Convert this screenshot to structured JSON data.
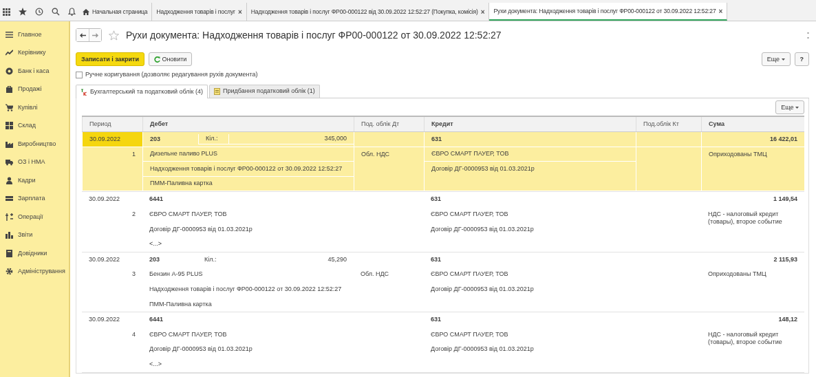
{
  "top_tabs": [
    {
      "kind": "home",
      "label": "Начальная страница",
      "closable": false,
      "selected": false
    },
    {
      "kind": "doc",
      "label": "Надходження товарів і послуг",
      "closable": true,
      "selected": false
    },
    {
      "kind": "doc",
      "label": "Надходження товарів і послуг ФР00-000122 від 30.09.2022 12:52:27 (Покупка, комісія)",
      "closable": true,
      "selected": false
    },
    {
      "kind": "doc",
      "label": "Рухи документа: Надходження товарів і послуг ФР00-000122 от 30.09.2022 12:52:27",
      "closable": true,
      "selected": true
    }
  ],
  "close_mark": "×",
  "sidebar": {
    "items": [
      {
        "kind": "menu",
        "label": "Главное"
      },
      {
        "kind": "trend",
        "label": "Керівнику"
      },
      {
        "kind": "bank",
        "label": "Банк і каса"
      },
      {
        "kind": "bag",
        "label": "Продажі"
      },
      {
        "kind": "cart",
        "label": "Купівлі"
      },
      {
        "kind": "grid",
        "label": "Склад"
      },
      {
        "kind": "factory",
        "label": "Виробництво"
      },
      {
        "kind": "truck",
        "label": "ОЗ і НМА"
      },
      {
        "kind": "person",
        "label": "Кадри"
      },
      {
        "kind": "cash",
        "label": "Зарплата"
      },
      {
        "kind": "ops",
        "label": "Операції"
      },
      {
        "kind": "bars",
        "label": "Звіти"
      },
      {
        "kind": "book",
        "label": "Довідники"
      },
      {
        "kind": "gear",
        "label": "Адміністрування"
      }
    ]
  },
  "title": "Рухи документа: Надходження товарів і послуг ФР00-000122 от 30.09.2022 12:52:27",
  "toolbar": {
    "save_button": "Записати і закрити",
    "refresh_button": "Оновити",
    "more_button": "Еще",
    "help_button": "?"
  },
  "manual_edit": {
    "label": "Ручне коригування (дозволяє редагування рухів документа)",
    "checked": false
  },
  "tabs": [
    {
      "kind": "ledger",
      "label": "Бухгалтерський та податковий облік (4)",
      "selected": true
    },
    {
      "kind": "tax",
      "label": "Придбання податковий облік (1)",
      "selected": false
    }
  ],
  "table": {
    "more_button": "Еще",
    "columns": [
      "Период",
      "Дебет",
      "Под. облік Дт",
      "Кредит",
      "Под.облік Кт",
      "Сума"
    ],
    "rows": [
      {
        "selected": true,
        "period": "30.09.2022",
        "number": "1",
        "debit_account": "203",
        "qty_label": "Кіл.:",
        "qty": "345,000",
        "debit_lines": [
          "Дизельне паливо PLUS",
          "Надходження товарів і послуг ФР00-000122 от 30.09.2022 12:52:27",
          "ПММ-Паливна картка"
        ],
        "tax_dt": "Обл. НДС",
        "credit_account": "631",
        "credit_lines": [
          "ЄВРО СМАРТ ПАУЕР, ТОВ",
          "Договір ДГ-0000953 від 01.03.2021р"
        ],
        "amount": "16 422,01",
        "content": "Оприходованы ТМЦ"
      },
      {
        "selected": false,
        "period": "30.09.2022",
        "number": "2",
        "debit_account": "6441",
        "debit_lines": [
          "ЄВРО СМАРТ ПАУЕР, ТОВ",
          "Договір ДГ-0000953 від 01.03.2021р",
          "<...>"
        ],
        "credit_account": "631",
        "credit_lines": [
          "ЄВРО СМАРТ ПАУЕР, ТОВ",
          "Договір ДГ-0000953 від 01.03.2021р"
        ],
        "amount": "1 149,54",
        "content": "НДС - налоговый кредит (товары), второе событие"
      },
      {
        "selected": false,
        "period": "30.09.2022",
        "number": "3",
        "debit_account": "203",
        "qty_label": "Кіл.:",
        "qty": "45,290",
        "debit_lines": [
          "Бензин А-95 PLUS",
          "Надходження товарів і послуг ФР00-000122 от 30.09.2022 12:52:27",
          "ПММ-Паливна картка"
        ],
        "tax_dt": "Обл. НДС",
        "credit_account": "631",
        "credit_lines": [
          "ЄВРО СМАРТ ПАУЕР, ТОВ",
          "Договір ДГ-0000953 від 01.03.2021р"
        ],
        "amount": "2 115,93",
        "content": "Оприходованы ТМЦ"
      },
      {
        "selected": false,
        "period": "30.09.2022",
        "number": "4",
        "debit_account": "6441",
        "debit_lines": [
          "ЄВРО СМАРТ ПАУЕР, ТОВ",
          "Договір ДГ-0000953 від 01.03.2021р",
          "<...>"
        ],
        "credit_account": "631",
        "credit_lines": [
          "ЄВРО СМАРТ ПАУЕР, ТОВ",
          "Договір ДГ-0000953 від 01.03.2021р"
        ],
        "amount": "148,12",
        "content": "НДС - налоговый кредит (товары), второе событие"
      }
    ]
  }
}
